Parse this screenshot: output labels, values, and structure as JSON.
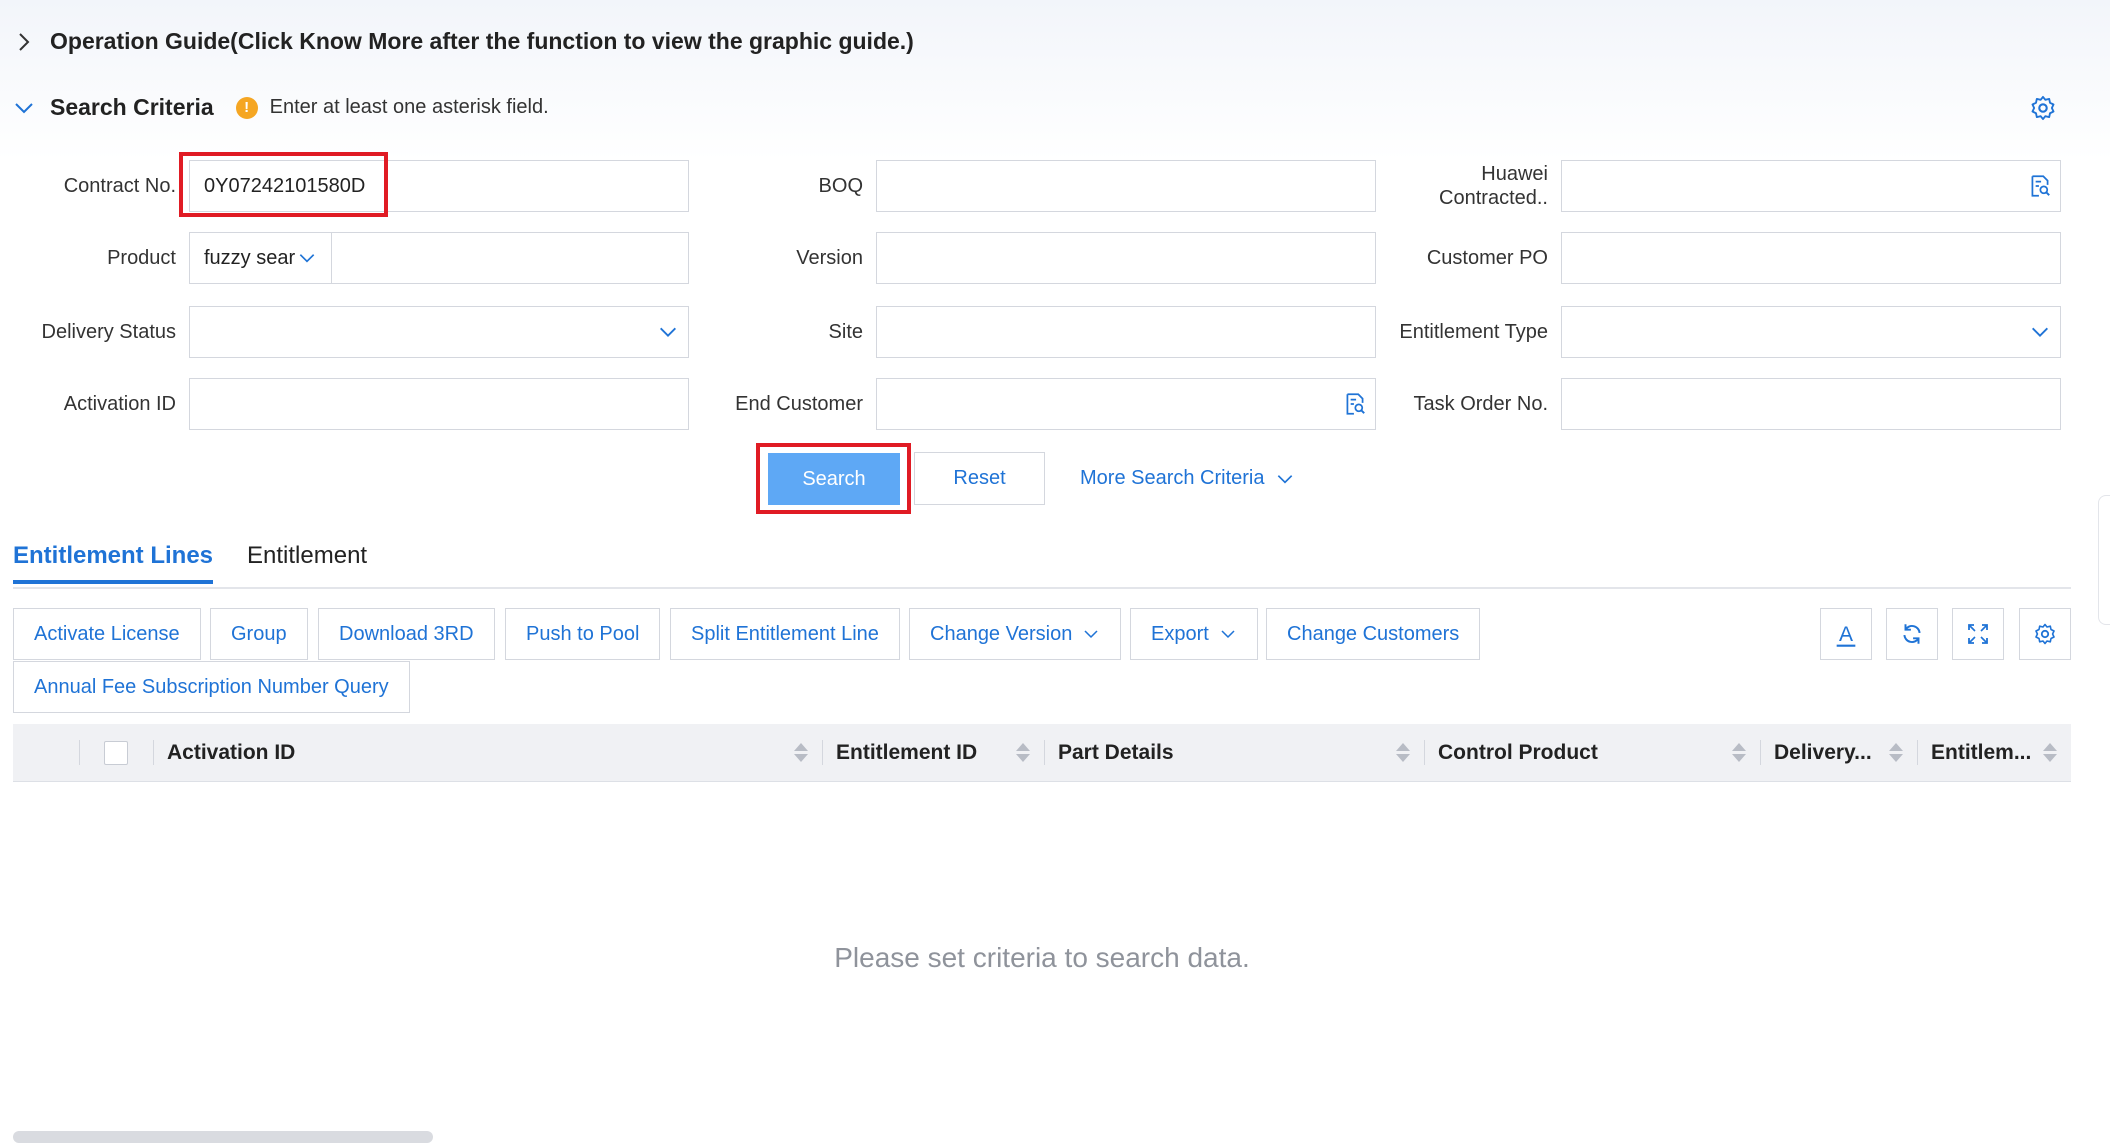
{
  "operation_guide": {
    "title": "Operation Guide(Click Know More after the function to view the graphic guide.)"
  },
  "search_criteria": {
    "title": "Search Criteria",
    "hint": "Enter at least one asterisk field.",
    "warn_symbol": "!"
  },
  "form": {
    "contract_no": {
      "label": "Contract No.",
      "value": "0Y07242101580D"
    },
    "boq": {
      "label": "BOQ",
      "value": ""
    },
    "huawei_contracted": {
      "label_line1": "Huawei",
      "label_line2": "Contracted..",
      "value": ""
    },
    "product": {
      "label": "Product",
      "mode": "fuzzy sear",
      "value": ""
    },
    "version": {
      "label": "Version",
      "value": ""
    },
    "customer_po": {
      "label": "Customer PO",
      "value": ""
    },
    "delivery_status": {
      "label": "Delivery Status",
      "value": ""
    },
    "site": {
      "label": "Site",
      "value": ""
    },
    "entitlement_type": {
      "label": "Entitlement Type",
      "value": ""
    },
    "activation_id": {
      "label": "Activation ID",
      "value": ""
    },
    "end_customer": {
      "label": "End Customer",
      "value": ""
    },
    "task_order_no": {
      "label": "Task Order No.",
      "value": ""
    }
  },
  "actions": {
    "search": "Search",
    "reset": "Reset",
    "more": "More Search Criteria"
  },
  "tabs": [
    {
      "label": "Entitlement Lines",
      "active": true
    },
    {
      "label": "Entitlement",
      "active": false
    }
  ],
  "toolbar": {
    "activate_license": "Activate License",
    "group": "Group",
    "download_3rd": "Download 3RD",
    "push_to_pool": "Push to Pool",
    "split_entitlement_line": "Split Entitlement Line",
    "change_version": "Change Version",
    "export": "Export",
    "change_customers": "Change Customers",
    "annual_fee_query": "Annual Fee Subscription Number Query",
    "font_icon_glyph": "A"
  },
  "table": {
    "columns": [
      "Activation ID",
      "Entitlement ID",
      "Part Details",
      "Control Product",
      "Delivery...",
      "Entitlem..."
    ],
    "empty_text": "Please set criteria to search data."
  },
  "colors": {
    "accent": "#1f73d6",
    "primary_button": "#5ea8f5",
    "highlight": "#e01b24",
    "warning": "#f5a623"
  }
}
